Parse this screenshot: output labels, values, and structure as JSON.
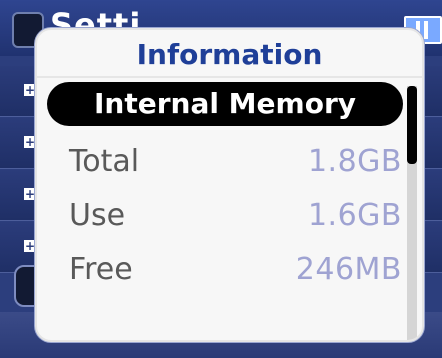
{
  "background": {
    "header_title": "Setti",
    "battery_icon": "battery-icon"
  },
  "dialog": {
    "title": "Information",
    "section": "Internal Memory",
    "rows": [
      {
        "label": "Total",
        "value": "1.8GB"
      },
      {
        "label": "Use",
        "value": "1.6GB"
      },
      {
        "label": "Free",
        "value": "246MB"
      }
    ]
  },
  "colors": {
    "title": "#1f3f98",
    "section_bg": "#000000",
    "value_text": "#9fa3d2",
    "label_text": "#595959",
    "background": "#2c3e7d"
  }
}
